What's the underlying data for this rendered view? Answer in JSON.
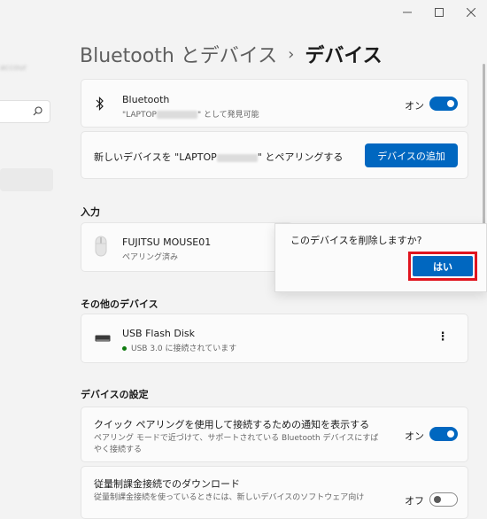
{
  "breadcrumb": {
    "parent": "Bluetooth とデバイス",
    "separator": "›",
    "current": "デバイス"
  },
  "bluetooth": {
    "title": "Bluetooth",
    "subtitle_prefix": "\"LAPTOP",
    "subtitle_suffix": "\" として発見可能",
    "toggle_label": "オン",
    "toggle_state": "on"
  },
  "pair": {
    "text_prefix": "新しいデバイスを \"LAPTOP",
    "text_suffix": "\" とペアリングする",
    "button_label": "デバイスの追加"
  },
  "input_section": {
    "header": "入力",
    "device": {
      "name": "FUJITSU MOUSE01",
      "status": "ペアリング済み"
    }
  },
  "popup": {
    "message": "このデバイスを削除しますか?",
    "confirm_label": "はい"
  },
  "other_section": {
    "header": "その他のデバイス",
    "device": {
      "name": "USB Flash Disk",
      "status": "USB 3.0 に接続されています",
      "more_label": "⋮"
    }
  },
  "settings_section": {
    "header": "デバイスの設定",
    "swift_pair": {
      "title": "クイック ペアリングを使用して接続するための通知を表示する",
      "desc_line1": "ペアリング モードで近づけて、サポートされている Bluetooth デバイスにすば",
      "desc_line2": "やく接続する",
      "toggle_label": "オン",
      "toggle_state": "on"
    },
    "metered": {
      "title": "従量制課金接続でのダウンロード",
      "desc_line1": "従量制課金接続を使っているときには、新しいデバイスのソフトウェア向け",
      "toggle_label": "オフ",
      "toggle_state": "off"
    }
  },
  "colors": {
    "accent": "#0067c0",
    "highlight_border": "#e0141e",
    "connected_dot": "#0f7b0f"
  }
}
